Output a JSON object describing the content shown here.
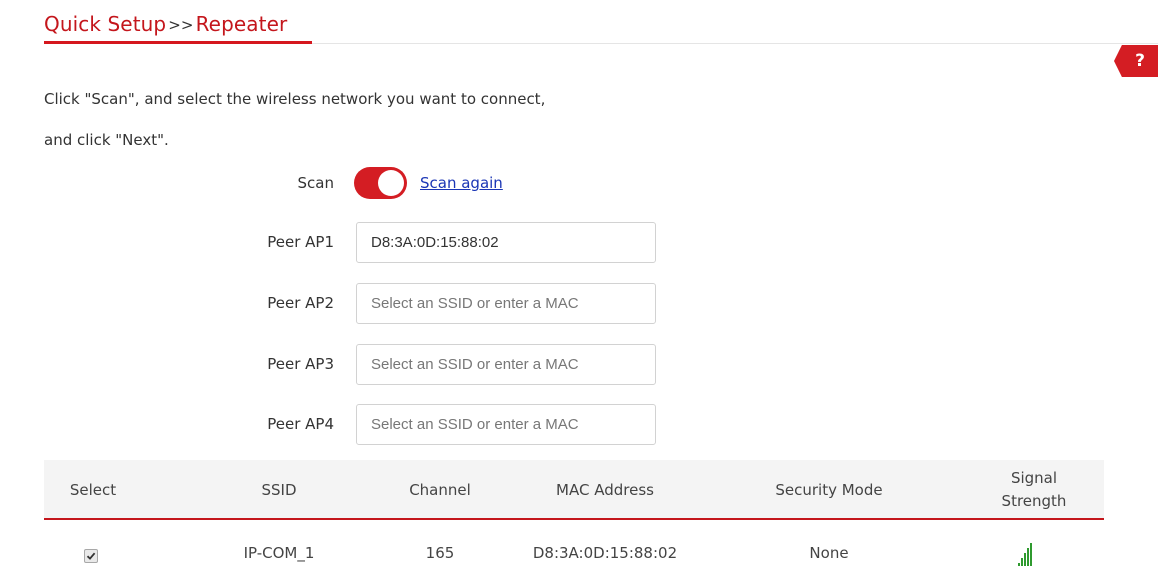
{
  "header": {
    "breadcrumb_part1": "Quick Setup",
    "breadcrumb_sep": ">>",
    "breadcrumb_part2": "Repeater",
    "accent_color": "#d41d23"
  },
  "help": {
    "label": "?"
  },
  "instruction": {
    "line1": "Click \"Scan\", and select the wireless network you want to connect,",
    "line2": "and click \"Next\"."
  },
  "scan": {
    "label": "Scan",
    "toggle_on": true,
    "scan_again_link": "Scan again"
  },
  "peer_aps": [
    {
      "label": "Peer AP1",
      "value": "D8:3A:0D:15:88:02",
      "placeholder": "Select an SSID or enter a MAC"
    },
    {
      "label": "Peer AP2",
      "value": "",
      "placeholder": "Select an SSID or enter a MAC"
    },
    {
      "label": "Peer AP3",
      "value": "",
      "placeholder": "Select an SSID or enter a MAC"
    },
    {
      "label": "Peer AP4",
      "value": "",
      "placeholder": "Select an SSID or enter a MAC"
    }
  ],
  "table": {
    "columns": [
      "Select",
      "SSID",
      "Channel",
      "MAC Address",
      "Security Mode",
      "Signal",
      "Strength"
    ],
    "rows": [
      {
        "selected": true,
        "ssid": "IP-COM_1",
        "channel": "165",
        "mac": "D8:3A:0D:15:88:02",
        "security": "None",
        "signal_icon": "signal-strength-icon",
        "signal_color": "#2f9a2f"
      }
    ]
  }
}
